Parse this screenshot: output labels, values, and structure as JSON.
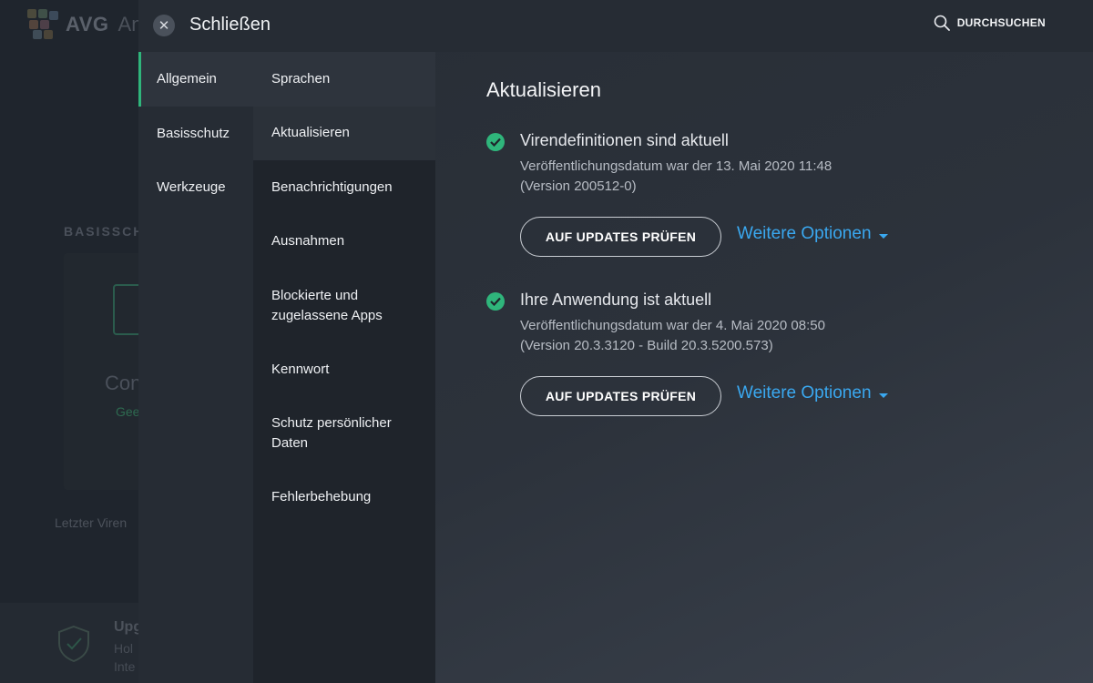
{
  "background": {
    "logo_text": "AVG",
    "logo_suffix": "An",
    "section_label": "BASISSCH",
    "card_title": "Con",
    "card_sub": "Gee",
    "last_scan": "Letzter Viren",
    "footer_title": "Upg",
    "footer_line1": "Hol",
    "footer_line2": "Inte"
  },
  "header": {
    "close_label": "Schließen",
    "search_label": "DURCHSUCHEN"
  },
  "nav_primary": [
    {
      "label": "Allgemein"
    },
    {
      "label": "Basisschutz"
    },
    {
      "label": "Werkzeuge"
    }
  ],
  "nav_secondary": [
    {
      "label": "Sprachen"
    },
    {
      "label": "Aktualisieren"
    },
    {
      "label": "Benachrichtigungen"
    },
    {
      "label": "Ausnahmen"
    },
    {
      "label": "Blockierte und zugelassene Apps"
    },
    {
      "label": "Kennwort"
    },
    {
      "label": "Schutz persönlicher Daten"
    },
    {
      "label": "Fehlerbehebung"
    }
  ],
  "content": {
    "title": "Aktualisieren",
    "blocks": [
      {
        "title": "Virendefinitionen sind aktuell",
        "line1": "Veröffentlichungsdatum war der 13. Mai 2020 11:48",
        "line2": "(Version 200512-0)",
        "button": "AUF UPDATES PRÜFEN",
        "link": "Weitere Optionen"
      },
      {
        "title": "Ihre Anwendung ist aktuell",
        "line1": "Veröffentlichungsdatum war der 4. Mai 2020 08:50",
        "line2": "(Version 20.3.3120 - Build 20.3.5200.573)",
        "button": "AUF UPDATES PRÜFEN",
        "link": "Weitere Optionen"
      }
    ]
  },
  "colors": {
    "accent_green": "#2fb57b",
    "link_blue": "#3aa8f0"
  }
}
